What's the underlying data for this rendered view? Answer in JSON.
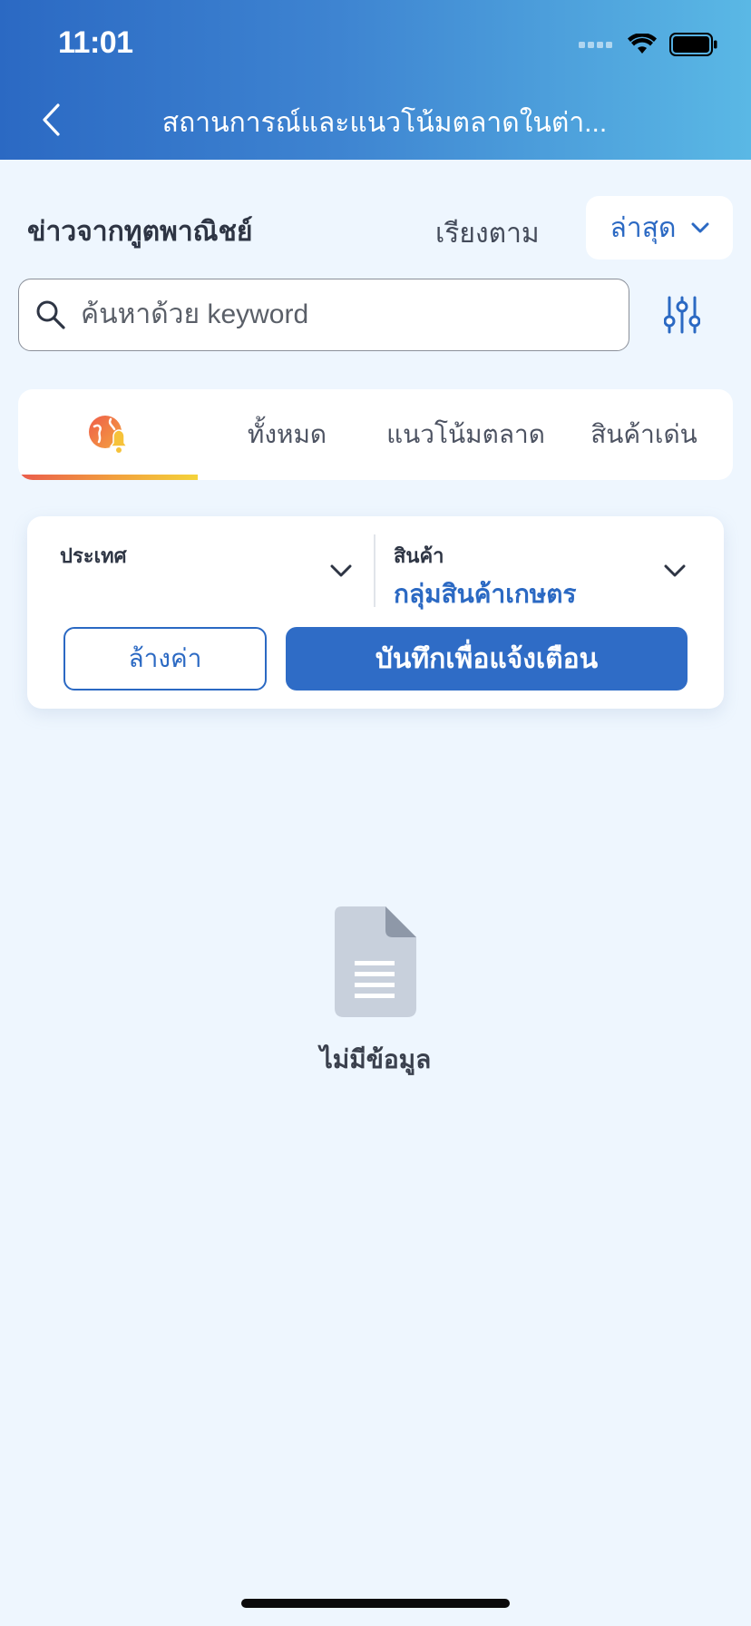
{
  "status_bar": {
    "time": "11:01"
  },
  "header": {
    "title": "สถานการณ์และแนวโน้มตลาดในต่า...",
    "gradient_start": "#2b69c3",
    "gradient_end": "#5ab8e5"
  },
  "section": {
    "title": "ข่าวจากทูตพาณิชย์",
    "sort_label": "เรียงตาม",
    "sort_value": "ล่าสุด"
  },
  "search": {
    "placeholder": "ค้นหาด้วย keyword"
  },
  "tabs": [
    {
      "icon": "globe-bell-icon",
      "label": "",
      "active": true
    },
    {
      "label": "ทั้งหมด",
      "active": false
    },
    {
      "label": "แนวโน้มตลาด",
      "active": false
    },
    {
      "label": "สินค้าเด่น",
      "active": false
    }
  ],
  "filters": {
    "country": {
      "label": "ประเทศ",
      "value": ""
    },
    "product": {
      "label": "สินค้า",
      "value": "กลุ่มสินค้าเกษตร"
    },
    "clear_label": "ล้างค่า",
    "save_label": "บันทึกเพื่อแจ้งเตือน"
  },
  "empty_state": {
    "icon": "document-icon",
    "text": "ไม่มีข้อมูล"
  },
  "colors": {
    "accent": "#2f6cc6",
    "background": "#eef6fe",
    "tab_underline_start": "#ea5b4c",
    "tab_underline_end": "#f4d33a"
  }
}
